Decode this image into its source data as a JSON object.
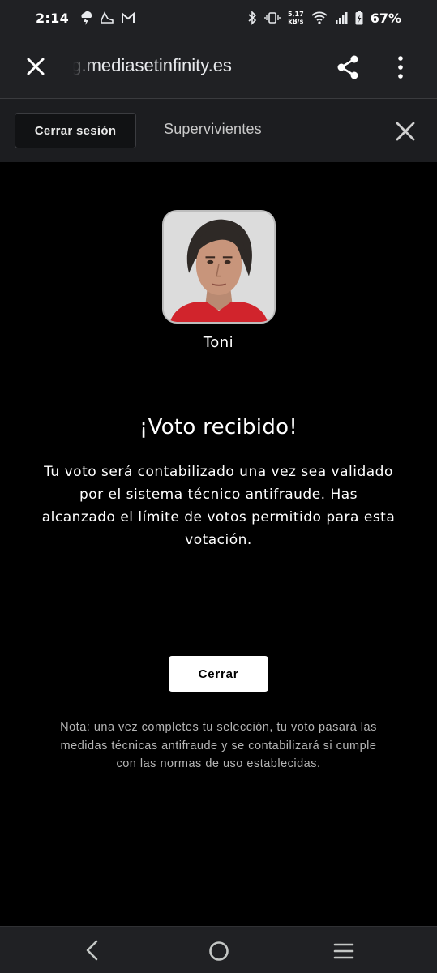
{
  "status_bar": {
    "time": "2:14",
    "network_speed_value": "5,17",
    "network_speed_unit": "kB/s",
    "battery": "67%"
  },
  "browser": {
    "url": "ng.mediasetinfinity.es"
  },
  "header": {
    "logout_label": "Cerrar sesión",
    "section_title": "Supervivientes"
  },
  "contestant": {
    "name": "Toni"
  },
  "result": {
    "title": "¡Voto recibido!",
    "message": "Tu voto será contabilizado una vez sea validado por el sistema técnico antifraude. Has alcanzado el límite de votos permitido para esta votación.",
    "close_label": "Cerrar",
    "note": "Nota: una vez completes tu selección, tu voto pasará las medidas técnicas antifraude y se contabilizará si cumple con las normas de uso establecidas."
  },
  "colors": {
    "background": "#000000",
    "bar": "#202124",
    "button_bg": "#ffffff",
    "shirt_red": "#d1242c"
  }
}
